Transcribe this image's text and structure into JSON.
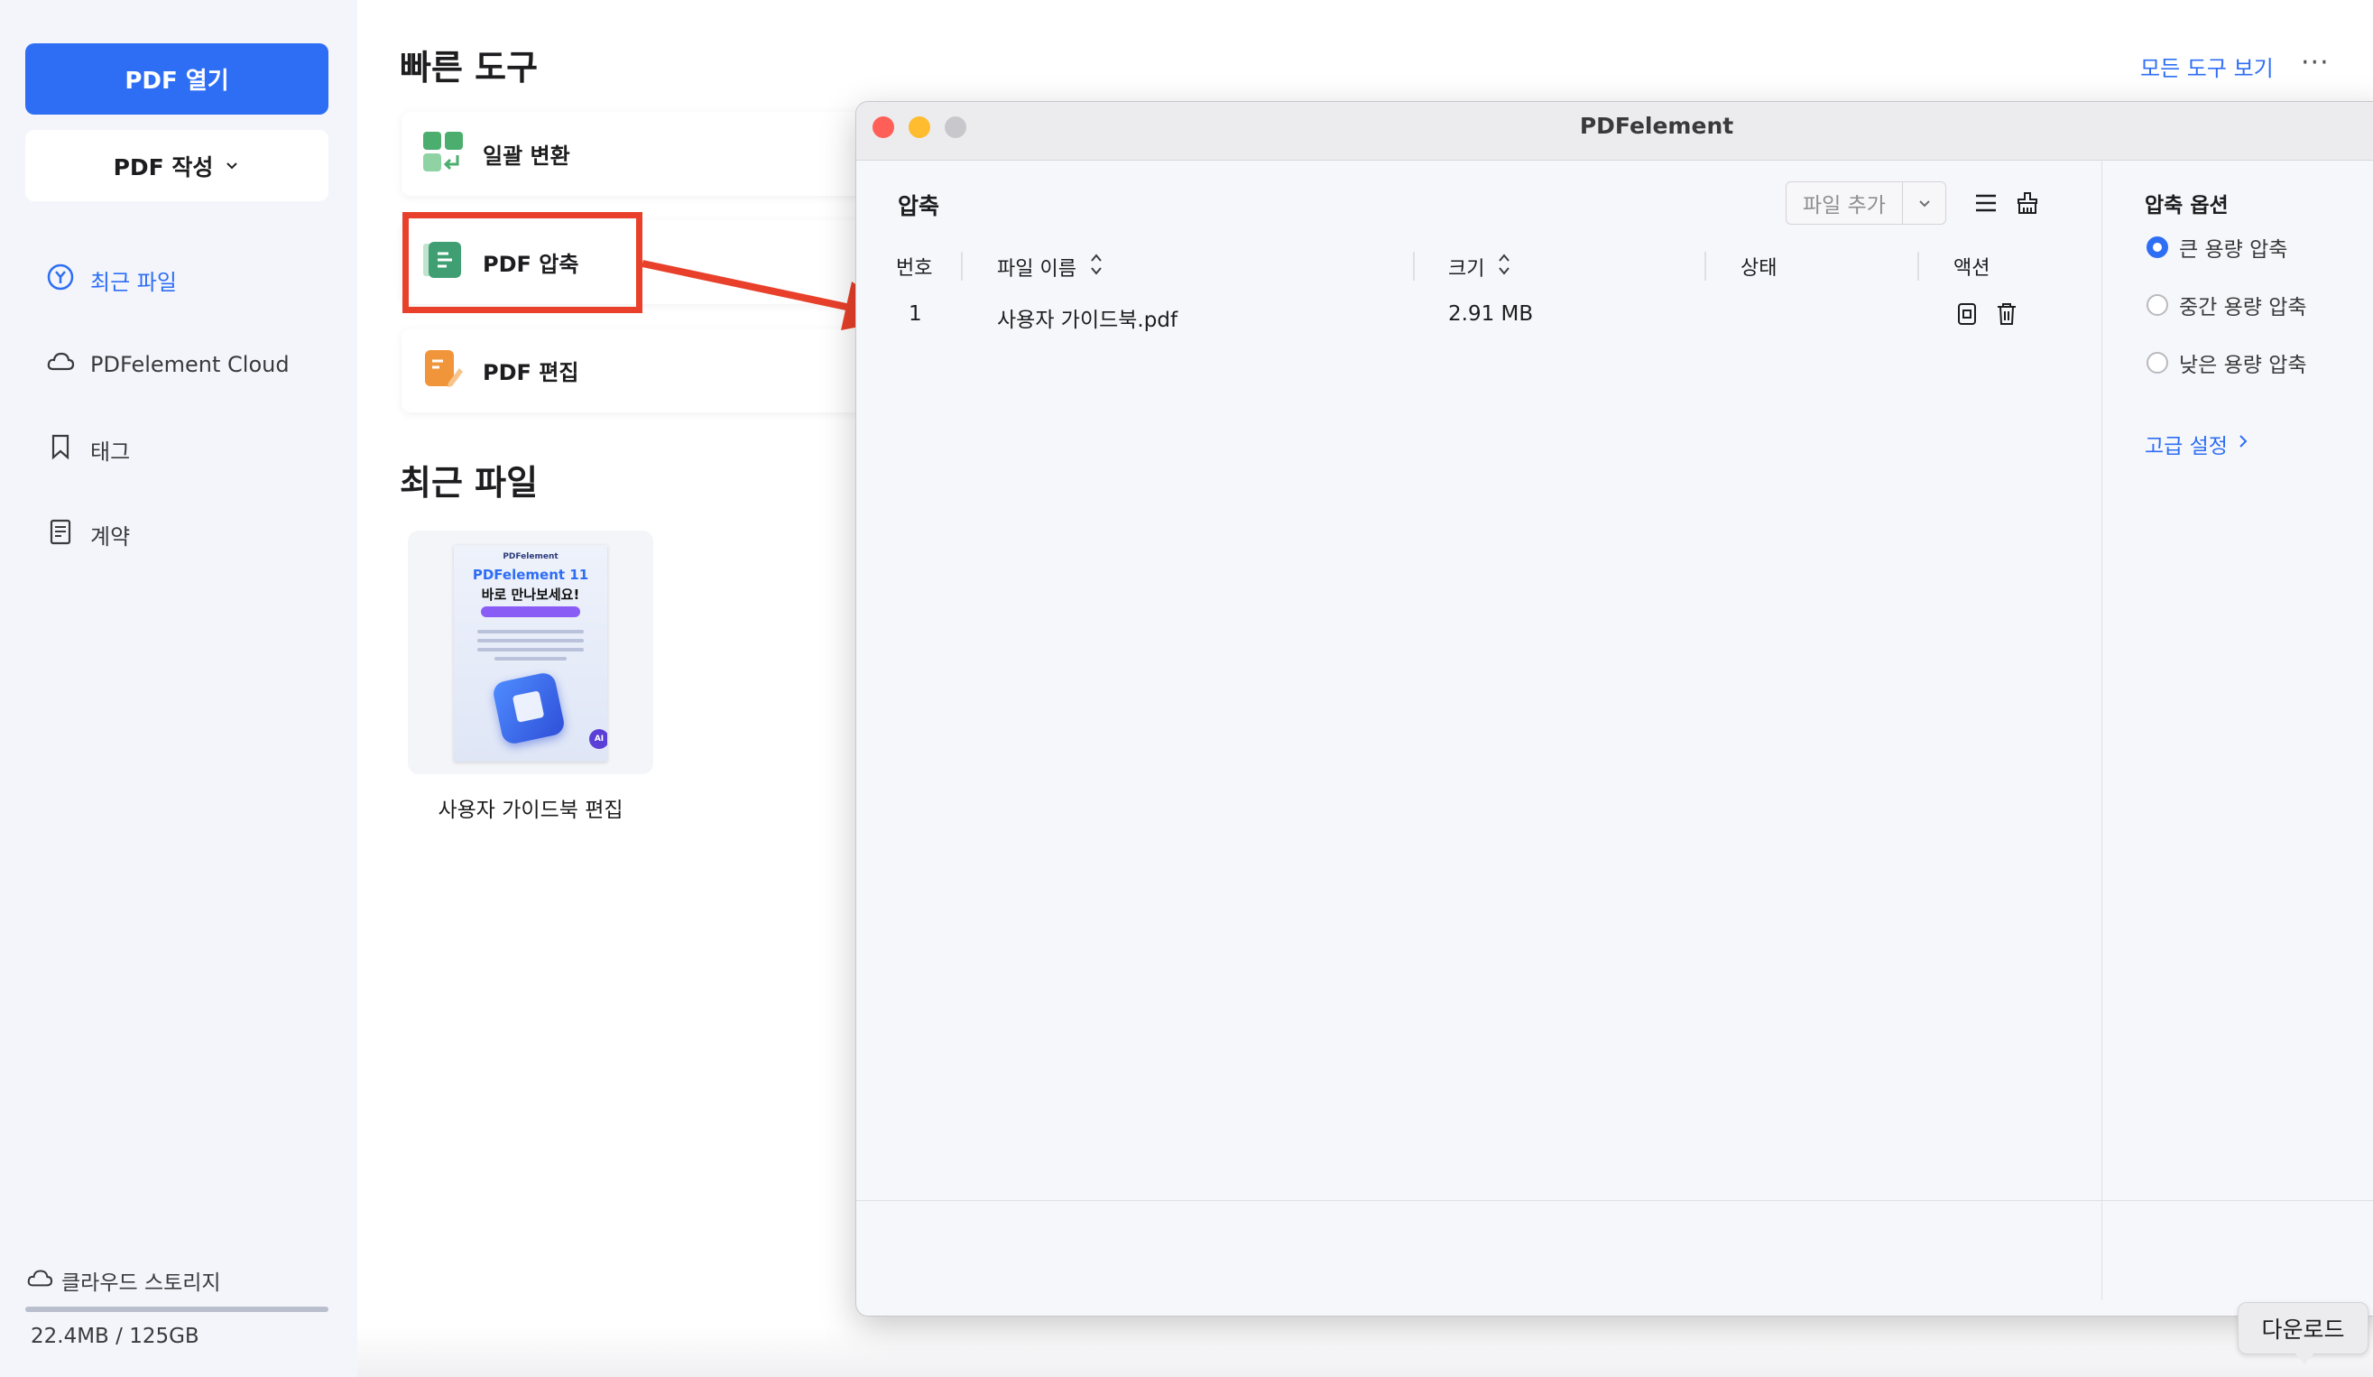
{
  "colors": {
    "accent": "#2e6ef5",
    "highlight_red": "#e8402a",
    "sidebar_bg": "#f3f5fa",
    "traffic_close": "#ff5f57",
    "traffic_minimize": "#febc2e",
    "traffic_zoom": "#c8c8cc"
  },
  "sidebar": {
    "open_pdf": "PDF 열기",
    "create_pdf": "PDF 작성",
    "items": [
      {
        "label": "최근 파일",
        "icon": "recent-icon"
      },
      {
        "label": "PDFelement Cloud",
        "icon": "cloud-icon"
      },
      {
        "label": "태그",
        "icon": "bookmark-icon"
      },
      {
        "label": "계약",
        "icon": "document-icon"
      }
    ],
    "storage": {
      "label": "클라우드 스토리지",
      "value": "22.4MB / 125GB",
      "used_fraction": 0.0002
    }
  },
  "main": {
    "quick_tools_title": "빠른 도구",
    "view_all_tools": "모든 도구 보기",
    "more": "···",
    "tools": [
      {
        "label": "일괄 변환",
        "icon": "batch-convert-icon"
      },
      {
        "label": "PDF 압축",
        "icon": "compress-icon"
      },
      {
        "label": "PDF 편집",
        "icon": "edit-icon"
      }
    ],
    "recent_title": "최근 파일",
    "recent_files": [
      {
        "name": "사용자 가이드북 편집",
        "thumb_brand": "PDFelement",
        "thumb_title1": "PDFelement 11",
        "thumb_title2": "바로 만나보세요!",
        "thumb_badge": "AI"
      }
    ]
  },
  "dialog": {
    "title": "PDFelement",
    "heading": "압축",
    "add_file": "파일 추가",
    "columns": {
      "number": "번호",
      "filename": "파일 이름",
      "size": "크기",
      "status": "상태",
      "action": "액션"
    },
    "rows": [
      {
        "number": "1",
        "filename": "사용자 가이드북.pdf",
        "size": "2.91 MB",
        "status": ""
      }
    ],
    "options": {
      "heading": "압축 옵션",
      "choices": [
        "큰 용량 압축",
        "중간 용량 압축",
        "낮은 용량 압축"
      ],
      "selected": "큰 용량 압축",
      "advanced": "고급 설정"
    }
  },
  "tooltip": "다운로드"
}
